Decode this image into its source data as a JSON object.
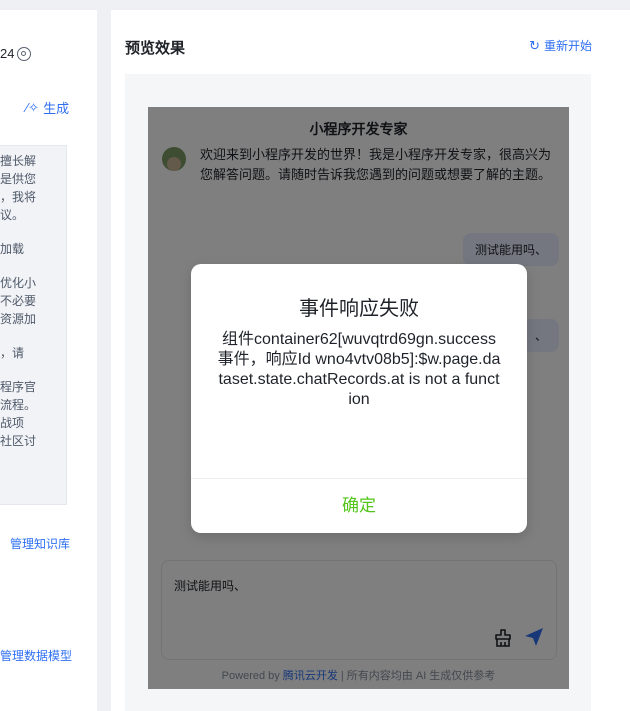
{
  "left_panel": {
    "top_text": "24",
    "generate_label": "生成",
    "prompt_paragraphs": [
      "擅长解\n是供您\n，我将\n议。",
      "加载",
      "优化小\n不必要\n资源加",
      "，请",
      "程序官\n流程。\n战项\n社区讨"
    ],
    "manage_knowledge_label": "管理知识库",
    "manage_data_model_label": "管理数据模型"
  },
  "preview": {
    "title": "预览效果",
    "restart_label": "重新开始",
    "phone": {
      "header": "小程序开发专家",
      "bot_message": "欢迎来到小程序开发的世界！我是小程序开发专家，很高兴为您解答问题。请随时告诉我您遇到的问题或想要了解的主题。",
      "user_message_1": "测试能用吗、",
      "user_message_2": "、",
      "input_value": "测试能用吗、",
      "footer_prefix": "Powered by ",
      "footer_link": "腾讯云开发",
      "footer_suffix": " | 所有内容均由 AI 生成仅供参考"
    }
  },
  "modal": {
    "title": "事件响应失败",
    "body": "组件container62[wuvqtrd69gn.success事件，响应Id wno4vtv08b5]:$w.page.dataset.state.chatRecords.at is not a function",
    "confirm_label": "确定"
  },
  "colors": {
    "accent": "#2e6ff2",
    "confirm": "#52c41a",
    "overlay": "rgba(0,0,0,0.5)"
  }
}
